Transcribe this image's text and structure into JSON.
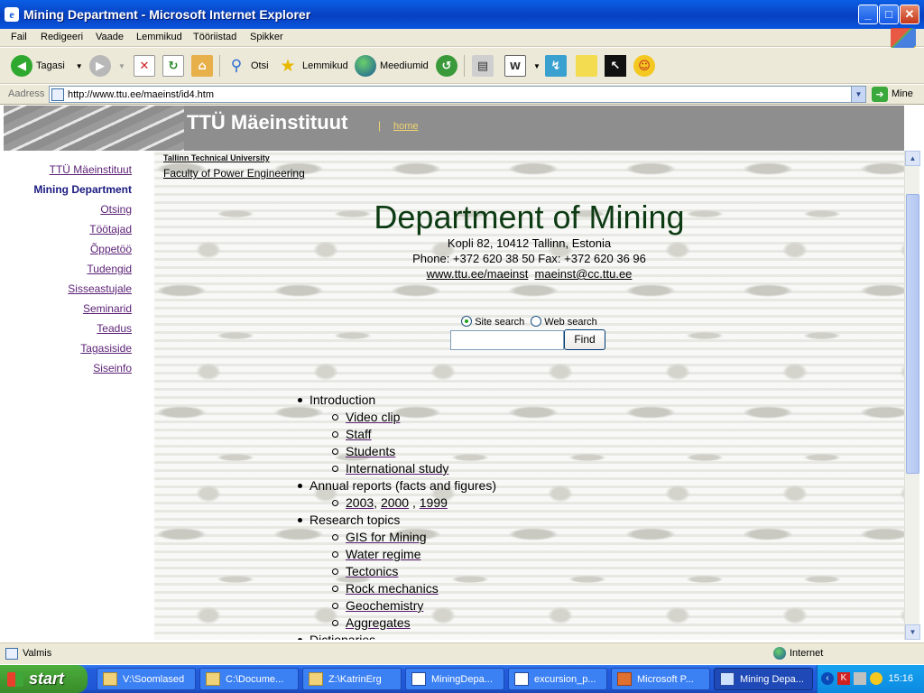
{
  "window": {
    "title": "Mining Department - Microsoft Internet Explorer",
    "buttons": [
      "_",
      "□",
      "✕"
    ]
  },
  "menu": [
    "Fail",
    "Redigeeri",
    "Vaade",
    "Lemmikud",
    "Tööriistad",
    "Spikker"
  ],
  "toolbar": {
    "back": "Tagasi",
    "search": "Otsi",
    "favorites": "Lemmikud",
    "media": "Meediumid"
  },
  "address": {
    "label": "Aadress",
    "url": "http://www.ttu.ee/maeinst/id4.htm",
    "go": "Mine"
  },
  "banner": {
    "title": "TTÜ Mäeinstituut",
    "separator": "|",
    "home": "home"
  },
  "sidebar": [
    {
      "label": "TTÜ Mäeinstituut",
      "current": false
    },
    {
      "label": "Mining Department",
      "current": true
    },
    {
      "label": "Otsing",
      "current": false
    },
    {
      "label": "Töötajad",
      "current": false
    },
    {
      "label": "Õppetöö",
      "current": false
    },
    {
      "label": "Tudengid",
      "current": false
    },
    {
      "label": "Sisseastujale",
      "current": false
    },
    {
      "label": "Seminarid",
      "current": false
    },
    {
      "label": "Teadus",
      "current": false
    },
    {
      "label": "Tagasiside",
      "current": false
    },
    {
      "label": "Siseinfo",
      "current": false
    }
  ],
  "page": {
    "university": "Tallinn Technical University",
    "faculty": "Faculty of Power Engineering",
    "heading": "Department of Mining",
    "address": "Kopli 82, 10412 Tallinn, Estonia",
    "phone": "Phone: +372 620 38 50 Fax: +372 620 36 96",
    "web": "www.ttu.ee/maeinst",
    "email": "maeinst@cc.ttu.ee",
    "search": {
      "opt_site": "Site search",
      "opt_web": "Web search",
      "selected": "Site search",
      "value": "",
      "button": "Find"
    },
    "sections": [
      {
        "title": "Introduction",
        "items": [
          "Video clip",
          "Staff",
          "Students",
          "International study"
        ]
      },
      {
        "title": "Annual reports (facts and figures)",
        "years": [
          "2003",
          "2000",
          "1999"
        ]
      },
      {
        "title": "Research topics",
        "items": [
          "GIS for Mining",
          "Water regime",
          "Tectonics",
          "Rock mechanics",
          "Geochemistry",
          "Aggregates"
        ]
      },
      {
        "title": "Dictionaries"
      }
    ]
  },
  "status": {
    "text": "Valmis",
    "zone": "Internet"
  },
  "taskbar": {
    "start": "start",
    "tasks": [
      "V:\\Soomlased",
      "C:\\Docume...",
      "Z:\\KatrinErg",
      "MiningDepa...",
      "excursion_p...",
      "Microsoft P...",
      "Mining Depa..."
    ],
    "active": "Mining Depa...",
    "clock": "15:16"
  },
  "colors": {
    "titlebar": "#0840c0",
    "banner": "#8e8e8e",
    "link": "#5a1f74",
    "current_link": "#1a1a80",
    "heading": "#0c3a12",
    "taskbar": "#245edc",
    "start": "#388c2a"
  }
}
